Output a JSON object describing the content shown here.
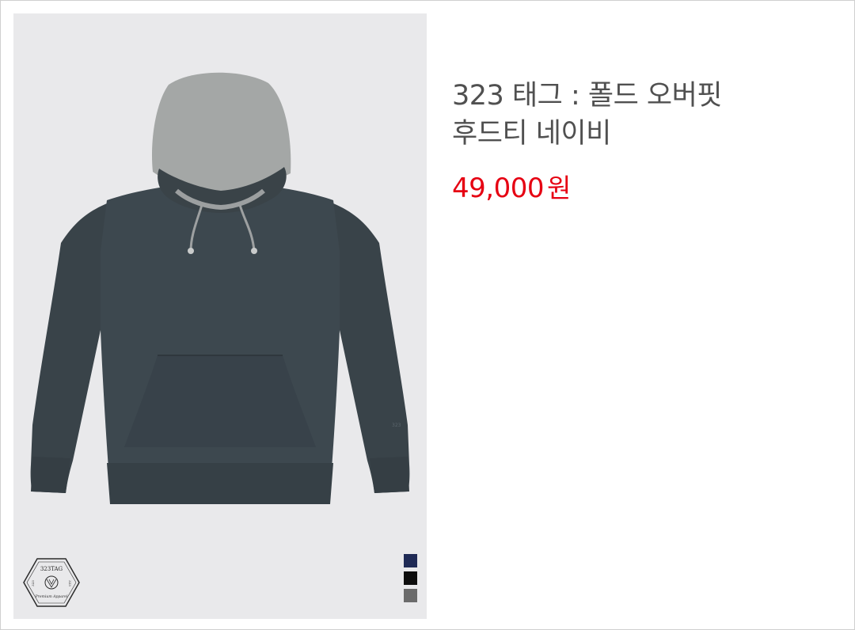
{
  "product": {
    "title_line1": "323 태그 : 폴드 오버핏",
    "title_line2": "후드티 네이비",
    "price": "49,000",
    "currency": "원",
    "image_alt": "navy hoodie with grey hood"
  },
  "logo": {
    "brand": "323TAG",
    "tagline": "Premium Apparel",
    "left_text": "323",
    "right_text": "323"
  },
  "colors": {
    "background": "#e9e9eb",
    "price": "#e60012",
    "title": "#505050",
    "hoodie_body": "#3b464e",
    "hood": "#a3a6a5"
  },
  "swatches": [
    {
      "name": "navy",
      "color": "#1f2a55"
    },
    {
      "name": "black",
      "color": "#0d0d0d"
    },
    {
      "name": "grey",
      "color": "#6b6b6b"
    }
  ]
}
